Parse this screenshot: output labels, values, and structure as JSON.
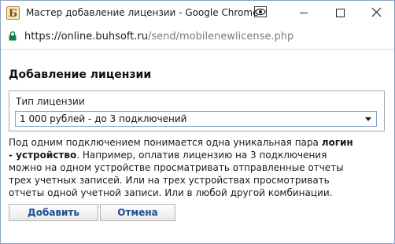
{
  "window": {
    "title": "Мастер добавление лицензии - Google Chrome",
    "app_icon_letter": "Б",
    "extension_icon": "eye-icon",
    "minimize_icon": "minimize-icon",
    "maximize_icon": "maximize-icon",
    "close_icon": "close-icon"
  },
  "address_bar": {
    "lock_icon": "lock-icon",
    "lock_color": "#0b8043",
    "url_host": "https://online.buhsoft.ru",
    "url_path": "/send/mobilenewlicense.php"
  },
  "form": {
    "heading": "Добавление лицензии",
    "license_type_legend": "Тип лицензии",
    "license_type_selected": "1 000 рублей - до 3 подключений",
    "description": {
      "part1": "Под одним подключением понимается одна уникальная пара ",
      "bold1": "логин - устройство",
      "part2": ". Например, оплатив лицензию на 3 подключения можно на одном устройстве просматривать отправленные отчеты трех учетных записей. Или на трех устройствах просмотривать отчеты одной учетной записи. Или в любой другой комбинации."
    },
    "add_button": "Добавить",
    "cancel_button": "Отмена",
    "button_text_color": "#1d4f91"
  }
}
